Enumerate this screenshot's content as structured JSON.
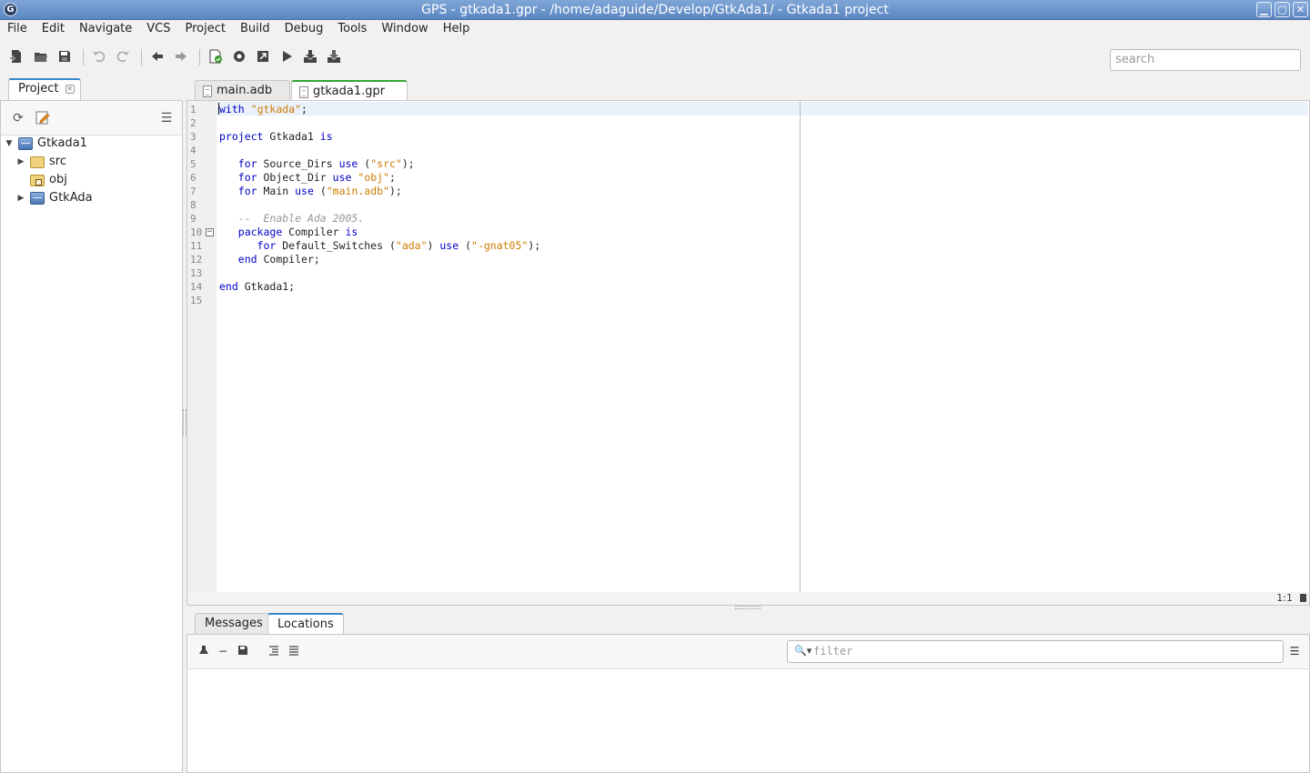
{
  "window": {
    "title": "GPS - gtkada1.gpr - /home/adaguide/Develop/GtkAda1/ - Gtkada1 project",
    "app_icon": "gps-app-icon",
    "controls": [
      "minimize",
      "maximize",
      "close"
    ]
  },
  "menu": [
    "File",
    "Edit",
    "Navigate",
    "VCS",
    "Project",
    "Build",
    "Debug",
    "Tools",
    "Window",
    "Help"
  ],
  "toolbar": {
    "icons": [
      "new-file-icon",
      "open-folder-icon",
      "save-icon",
      "undo-icon",
      "redo-icon",
      "back-arrow-icon",
      "forward-arrow-icon",
      "build-check-icon",
      "compile-icon",
      "build-all-icon",
      "run-icon",
      "download-icon",
      "install-icon"
    ],
    "search_placeholder": "search"
  },
  "project_panel": {
    "tab_label": "Project",
    "tree": [
      {
        "label": "Gtkada1",
        "type": "project",
        "expanded": true,
        "depth": 0
      },
      {
        "label": "src",
        "type": "folder",
        "expanded": false,
        "depth": 1
      },
      {
        "label": "obj",
        "type": "folder-locked",
        "expanded": false,
        "depth": 1
      },
      {
        "label": "GtkAda",
        "type": "project",
        "expanded": false,
        "depth": 1
      }
    ]
  },
  "editor": {
    "tabs": [
      {
        "label": "main.adb",
        "active": false
      },
      {
        "label": "gtkada1.gpr",
        "active": true
      }
    ],
    "lines": [
      {
        "n": "1",
        "tokens": [
          [
            "kw",
            "with"
          ],
          [
            "",
            ""
          ],
          [
            "str",
            "\"gtkada\""
          ],
          [
            "",
            ";"
          ]
        ]
      },
      {
        "n": "2",
        "tokens": []
      },
      {
        "n": "3",
        "tokens": [
          [
            "kw",
            "project"
          ],
          [
            "",
            " Gtkada1 "
          ],
          [
            "kw",
            "is"
          ]
        ]
      },
      {
        "n": "4",
        "tokens": []
      },
      {
        "n": "5",
        "tokens": [
          [
            "",
            "   "
          ],
          [
            "kw",
            "for"
          ],
          [
            "",
            " Source_Dirs "
          ],
          [
            "kw",
            "use"
          ],
          [
            "",
            " ("
          ],
          [
            "str",
            "\"src\""
          ],
          [
            "",
            ");"
          ]
        ]
      },
      {
        "n": "6",
        "tokens": [
          [
            "",
            "   "
          ],
          [
            "kw",
            "for"
          ],
          [
            "",
            " Object_Dir "
          ],
          [
            "kw",
            "use"
          ],
          [
            "",
            " "
          ],
          [
            "str",
            "\"obj\""
          ],
          [
            "",
            ";"
          ]
        ]
      },
      {
        "n": "7",
        "tokens": [
          [
            "",
            "   "
          ],
          [
            "kw",
            "for"
          ],
          [
            "",
            " Main "
          ],
          [
            "kw",
            "use"
          ],
          [
            "",
            " ("
          ],
          [
            "str",
            "\"main.adb\""
          ],
          [
            "",
            ");"
          ]
        ]
      },
      {
        "n": "8",
        "tokens": []
      },
      {
        "n": "9",
        "tokens": [
          [
            "",
            "   "
          ],
          [
            "cmt",
            "--  Enable Ada 2005."
          ]
        ]
      },
      {
        "n": "10",
        "fold": true,
        "tokens": [
          [
            "",
            "   "
          ],
          [
            "kw",
            "package"
          ],
          [
            "",
            " Compiler "
          ],
          [
            "kw",
            "is"
          ]
        ]
      },
      {
        "n": "11",
        "tokens": [
          [
            "",
            "      "
          ],
          [
            "kw",
            "for"
          ],
          [
            "",
            " Default_Switches ("
          ],
          [
            "str",
            "\"ada\""
          ],
          [
            "",
            ") "
          ],
          [
            "kw",
            "use"
          ],
          [
            "",
            " ("
          ],
          [
            "str",
            "\"-gnat05\""
          ],
          [
            "",
            ");"
          ]
        ]
      },
      {
        "n": "12",
        "tokens": [
          [
            "",
            "   "
          ],
          [
            "kw",
            "end"
          ],
          [
            "",
            " Compiler;"
          ]
        ]
      },
      {
        "n": "13",
        "tokens": []
      },
      {
        "n": "14",
        "tokens": [
          [
            "kw",
            "end"
          ],
          [
            "",
            " Gtkada1;"
          ]
        ]
      },
      {
        "n": "15",
        "tokens": []
      }
    ],
    "cursor_position": "1:1"
  },
  "bottom_panel": {
    "tabs": [
      {
        "label": "Messages",
        "active": false
      },
      {
        "label": "Locations",
        "active": true
      }
    ],
    "filter_placeholder": "filter",
    "icons": [
      "clear-icon",
      "remove-icon",
      "save-icon",
      "expand-all-icon",
      "collapse-all-icon",
      "menu-icon"
    ]
  },
  "colors": {
    "keyword": "#0000c8",
    "string": "#ce7b00",
    "comment": "#969696",
    "titlebar": "#6f98cf",
    "active_editor_tab": "#3aa23a"
  }
}
